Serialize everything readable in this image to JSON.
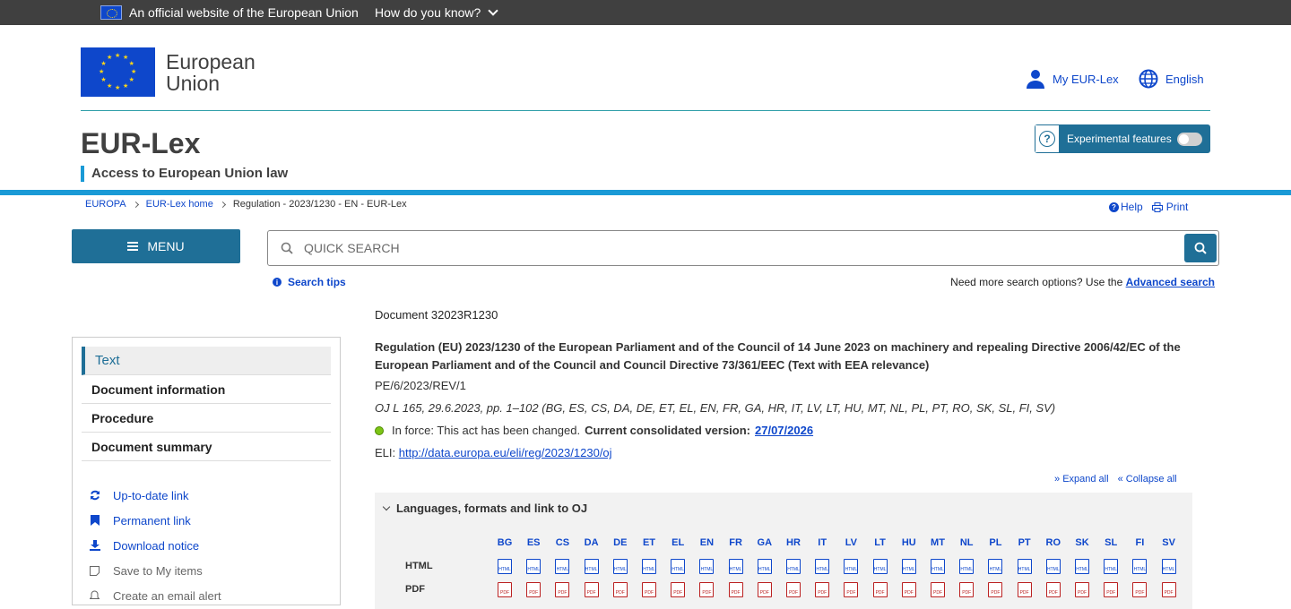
{
  "eu_bar": {
    "official": "An official website of the European Union",
    "how": "How do you know?"
  },
  "header": {
    "logo_line1": "European",
    "logo_line2": "Union",
    "my_eurlex": "My EUR-Lex",
    "language": "English",
    "site_title": "EUR-Lex",
    "site_subtitle": "Access to European Union law",
    "experimental": "Experimental features"
  },
  "breadcrumb": [
    "EUROPA",
    "EUR-Lex home",
    "Regulation - 2023/1230 - EN - EUR-Lex"
  ],
  "tools": {
    "help": "Help",
    "print": "Print"
  },
  "menu": {
    "label": "MENU"
  },
  "search": {
    "placeholder": "QUICK SEARCH",
    "tips": "Search tips",
    "more_prefix": "Need more search options? Use the",
    "advanced": "Advanced search"
  },
  "sidebar": {
    "nav": [
      "Text",
      "Document information",
      "Procedure",
      "Document summary"
    ],
    "links": [
      "Up-to-date link",
      "Permanent link",
      "Download notice",
      "Save to My items",
      "Create an email alert"
    ]
  },
  "document": {
    "number": "Document 32023R1230",
    "title": "Regulation (EU) 2023/1230 of the European Parliament and of the Council of 14 June 2023 on machinery and repealing Directive 2006/42/EC of the European Parliament and of the Council and Council Directive 73/361/EEC (Text with EEA relevance)",
    "ref": "PE/6/2023/REV/1",
    "oj": "OJ L 165, 29.6.2023, pp. 1–102 (BG, ES, CS, DA, DE, ET, EL, EN, FR, GA, HR, IT, LV, LT, HU, MT, NL, PL, PT, RO, SK, SL, FI, SV)",
    "force_text": "In force: This act has been changed.",
    "consolidated_label": "Current consolidated version:",
    "consolidated_date": "27/07/2026",
    "eli_label": "ELI:",
    "eli_url": "http://data.europa.eu/eli/reg/2023/1230/oj",
    "expand_all": "Expand all",
    "collapse_all": "Collapse all"
  },
  "languages_panel": {
    "heading": "Languages, formats and link to OJ",
    "codes": [
      "BG",
      "ES",
      "CS",
      "DA",
      "DE",
      "ET",
      "EL",
      "EN",
      "FR",
      "GA",
      "HR",
      "IT",
      "LV",
      "LT",
      "HU",
      "MT",
      "NL",
      "PL",
      "PT",
      "RO",
      "SK",
      "SL",
      "FI",
      "SV"
    ],
    "rows": [
      "HTML",
      "PDF"
    ],
    "icon_labels": {
      "html": "HTML",
      "pdf": "PDF"
    }
  },
  "colors": {
    "primary": "#1f6f97",
    "link": "#0e47cb",
    "accent_line": "#1a9ad6",
    "eu_blue": "#0e47cb",
    "eu_gold": "#ffd617"
  }
}
